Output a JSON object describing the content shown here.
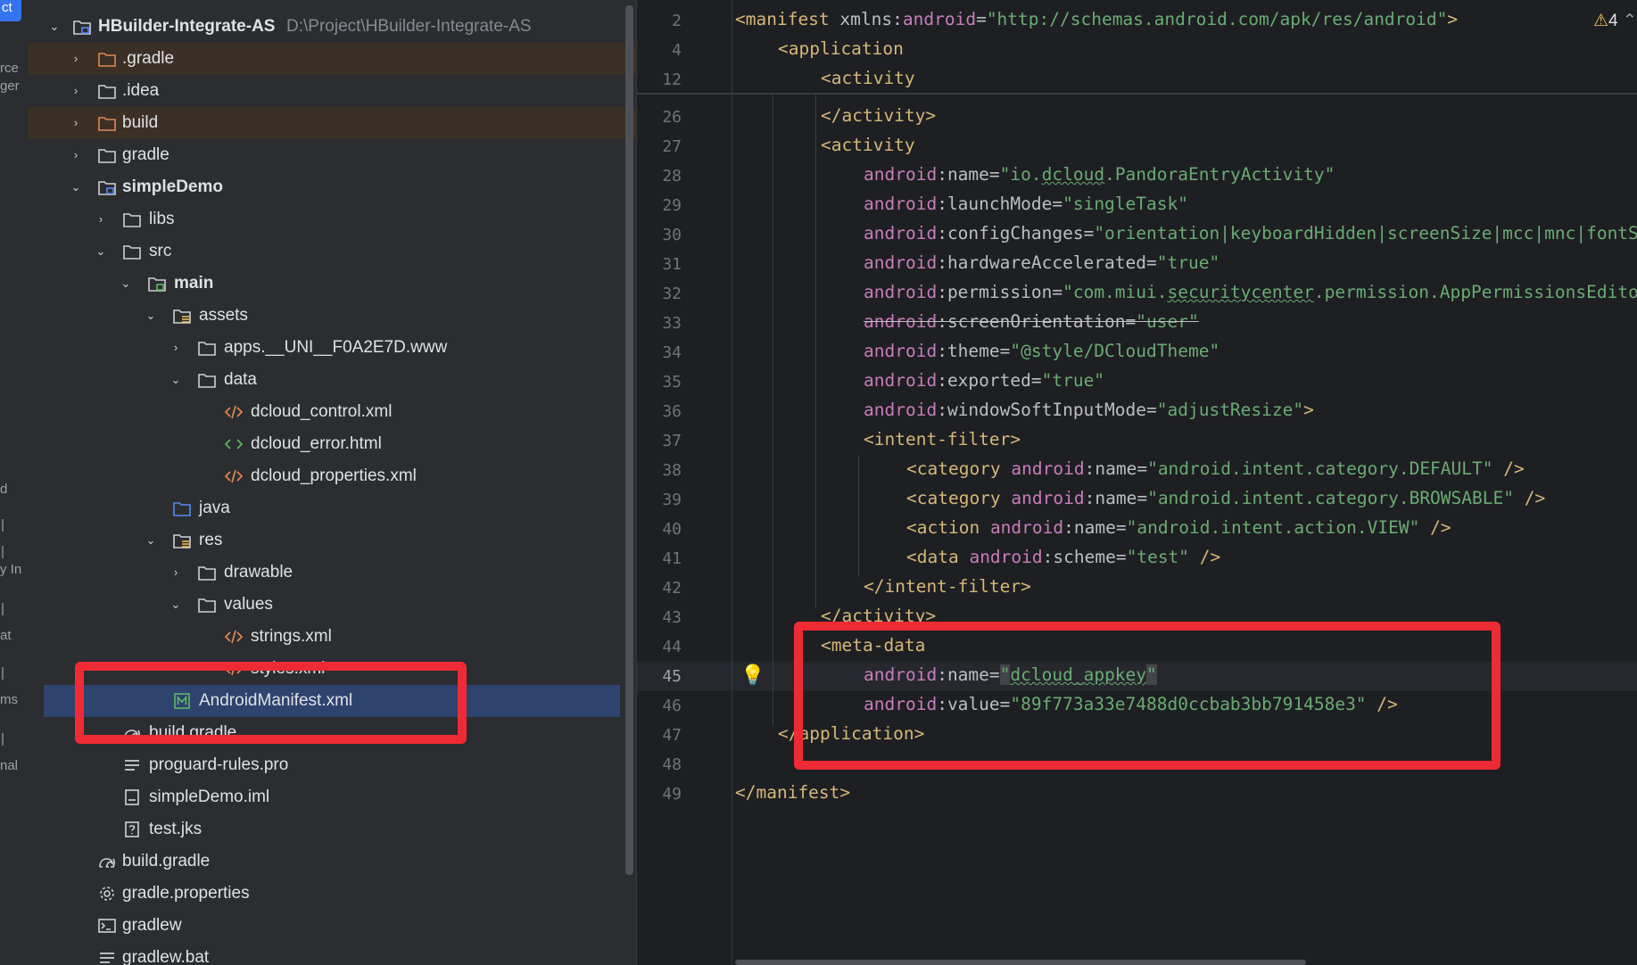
{
  "left_strip": {
    "tab": "ct",
    "fragments": [
      "rce",
      "ger",
      "d",
      "y In",
      "at",
      "ms",
      "nal"
    ]
  },
  "project_tree": {
    "root_name": "HBuilder-Integrate-AS",
    "root_path": "D:\\Project\\HBuilder-Integrate-AS",
    "items": [
      {
        "label": ".gradle",
        "type": "folder-excluded"
      },
      {
        "label": ".idea",
        "type": "folder"
      },
      {
        "label": "build",
        "type": "folder-excluded"
      },
      {
        "label": "gradle",
        "type": "folder"
      },
      {
        "label": "simpleDemo",
        "type": "module"
      },
      {
        "label": "libs",
        "type": "folder"
      },
      {
        "label": "src",
        "type": "folder"
      },
      {
        "label": "main",
        "type": "source-set"
      },
      {
        "label": "assets",
        "type": "resource-folder"
      },
      {
        "label": "apps.__UNI__F0A2E7D.www",
        "type": "folder"
      },
      {
        "label": "data",
        "type": "folder"
      },
      {
        "label": "dcloud_control.xml",
        "type": "xml-file"
      },
      {
        "label": "dcloud_error.html",
        "type": "html-file"
      },
      {
        "label": "dcloud_properties.xml",
        "type": "xml-file"
      },
      {
        "label": "java",
        "type": "source-folder"
      },
      {
        "label": "res",
        "type": "resource-folder"
      },
      {
        "label": "drawable",
        "type": "folder"
      },
      {
        "label": "values",
        "type": "folder"
      },
      {
        "label": "strings.xml",
        "type": "xml-file"
      },
      {
        "label": "styles.xml",
        "type": "xml-file"
      },
      {
        "label": "AndroidManifest.xml",
        "type": "manifest-file",
        "selected": true
      },
      {
        "label": "build.gradle",
        "type": "gradle-file"
      },
      {
        "label": "proguard-rules.pro",
        "type": "text-file"
      },
      {
        "label": "simpleDemo.iml",
        "type": "iml-file"
      },
      {
        "label": "test.jks",
        "type": "unknown-file"
      },
      {
        "label": "build.gradle",
        "type": "gradle-file"
      },
      {
        "label": "gradle.properties",
        "type": "settings-file"
      },
      {
        "label": "gradlew",
        "type": "script-file"
      },
      {
        "label": "gradlew.bat",
        "type": "text-file"
      }
    ]
  },
  "editor": {
    "inspection_count": "4",
    "line_numbers": [
      "2",
      "4",
      "12",
      "26",
      "27",
      "28",
      "29",
      "30",
      "31",
      "32",
      "33",
      "34",
      "35",
      "36",
      "37",
      "38",
      "39",
      "40",
      "41",
      "42",
      "43",
      "44",
      "45",
      "46",
      "47",
      "48",
      "49"
    ],
    "current_line": "45",
    "text": {
      "manifest_tag": "<manifest",
      "xmlns": "xmlns",
      "android": "android",
      "manifest_ns_value": "\"http://schemas.android.com/apk/res/android\"",
      "application_open": "<application",
      "activity_open": "<activity",
      "activity_close": "</activity>",
      "activity_name_value_pre": "\"io.",
      "activity_name_value_sq": "dcloud",
      "activity_name_value_post": ".PandoraEntryActivity\"",
      "launch_mode_value": "\"singleTask\"",
      "config_changes_value": "\"orientation|keyboardHidden|screenSize|mcc|mnc|fontSc",
      "hw_accel_value": "\"true\"",
      "permission_value_pre": "\"com.miui.",
      "permission_value_sq": "securitycenter",
      "permission_value_post": ".permission.AppPermissionsEditor",
      "screen_orientation_value": "\"user\"",
      "theme_value": "\"@style/DCloudTheme\"",
      "exported_value": "\"true\"",
      "soft_input_value": "\"adjustResize\"",
      "intent_filter_open": "<intent-filter>",
      "intent_filter_close": "</intent-filter>",
      "category_tag": "<category",
      "category_default_value": "\"android.intent.category.DEFAULT\"",
      "category_browsable_value": "\"android.intent.category.BROWSABLE\"",
      "action_tag": "<action",
      "action_view_value": "\"android.intent.action.VIEW\"",
      "data_tag": "<data",
      "scheme_value": "\"test\"",
      "self_close": " />",
      "tag_close": ">",
      "meta_data_open": "<meta-data",
      "meta_name_value_q1": "\"",
      "meta_name_value_sq": "dcloud_appkey",
      "meta_name_value_q2": "\"",
      "meta_value_value": "\"89f773a33e7488d0ccbab3bb791458e3\"",
      "application_close": "</application>",
      "manifest_close": "</manifest>",
      "attr_name": "name",
      "attr_launch_mode": "launchMode",
      "attr_config_changes": "configChanges",
      "attr_hw_accel": "hardwareAccelerated",
      "attr_permission": "permission",
      "attr_screen_orientation": "screenOrientation",
      "attr_theme": "theme",
      "attr_exported": "exported",
      "attr_soft_input": "windowSoftInputMode",
      "attr_scheme": "scheme",
      "attr_value": "value",
      "colon": ":",
      "eq": "="
    }
  },
  "colors": {
    "background": "#1e1f22",
    "panel": "#2b2d30",
    "tag": "#d5b778",
    "namespace": "#c77dbb",
    "string": "#6aab73",
    "text": "#bcbec4",
    "selection": "#2e436e",
    "excluded_highlight": "#3b3026",
    "annotation_red": "#ee2b34"
  }
}
